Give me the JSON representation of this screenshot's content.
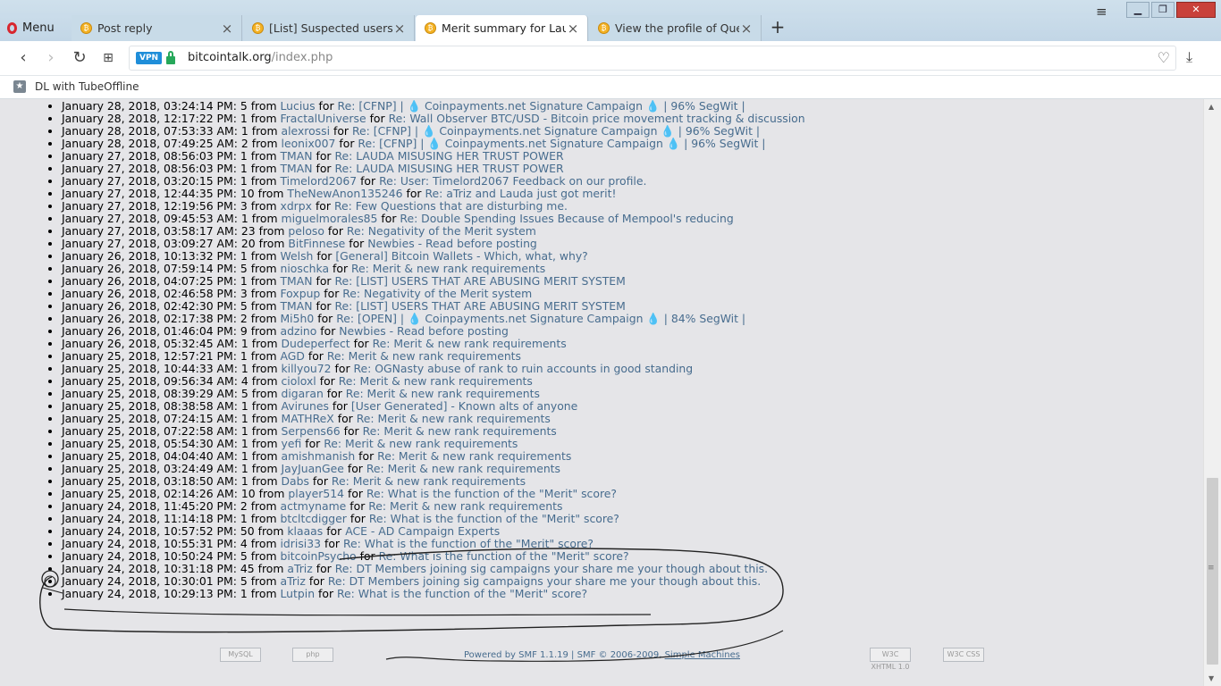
{
  "browser": {
    "menu_label": "Menu",
    "tabs": [
      {
        "title": "Post reply"
      },
      {
        "title": "[List] Suspected users that"
      },
      {
        "title": "Merit summary for Lauda"
      },
      {
        "title": "View the profile of Questio"
      }
    ],
    "new_tab": "+",
    "vpn_label": "VPN",
    "url_host": "bitcointalk.org",
    "url_path": "/index.php",
    "bookmark": "DL with TubeOffline"
  },
  "merits": [
    {
      "date": "January 28, 2018, 03:24:14 PM",
      "amount": "5",
      "user": "Lucius",
      "topic": "Re: [CFNP] | 💧 Coinpayments.net Signature Campaign 💧 | 96% SegWit |"
    },
    {
      "date": "January 28, 2018, 12:17:22 PM",
      "amount": "1",
      "user": "FractalUniverse",
      "topic": "Re: Wall Observer BTC/USD - Bitcoin price movement tracking & discussion"
    },
    {
      "date": "January 28, 2018, 07:53:33 AM",
      "amount": "1",
      "user": "alexrossi",
      "topic": "Re: [CFNP] | 💧 Coinpayments.net Signature Campaign 💧 | 96% SegWit |"
    },
    {
      "date": "January 28, 2018, 07:49:25 AM",
      "amount": "2",
      "user": "leonix007",
      "topic": "Re: [CFNP] | 💧 Coinpayments.net Signature Campaign 💧 | 96% SegWit |"
    },
    {
      "date": "January 27, 2018, 08:56:03 PM",
      "amount": "1",
      "user": "TMAN",
      "topic": "Re: LAUDA MISUSING HER TRUST POWER"
    },
    {
      "date": "January 27, 2018, 08:56:03 PM",
      "amount": "1",
      "user": "TMAN",
      "topic": "Re: LAUDA MISUSING HER TRUST POWER"
    },
    {
      "date": "January 27, 2018, 03:20:15 PM",
      "amount": "1",
      "user": "Timelord2067",
      "topic": "Re: User: Timelord2067 Feedback on our profile."
    },
    {
      "date": "January 27, 2018, 12:44:35 PM",
      "amount": "10",
      "user": "TheNewAnon135246",
      "topic": "Re: aTriz and Lauda just got merit!"
    },
    {
      "date": "January 27, 2018, 12:19:56 PM",
      "amount": "3",
      "user": "xdrpx",
      "topic": "Re: Few Questions that are disturbing me."
    },
    {
      "date": "January 27, 2018, 09:45:53 AM",
      "amount": "1",
      "user": "miguelmorales85",
      "topic": "Re: Double Spending Issues Because of Mempool's reducing"
    },
    {
      "date": "January 27, 2018, 03:58:17 AM",
      "amount": "23",
      "user": "peloso",
      "topic": "Re: Negativity of the Merit system"
    },
    {
      "date": "January 27, 2018, 03:09:27 AM",
      "amount": "20",
      "user": "BitFinnese",
      "topic": "Newbies - Read before posting"
    },
    {
      "date": "January 26, 2018, 10:13:32 PM",
      "amount": "1",
      "user": "Welsh",
      "topic": "[General] Bitcoin Wallets - Which, what, why?"
    },
    {
      "date": "January 26, 2018, 07:59:14 PM",
      "amount": "5",
      "user": "nioschka",
      "topic": "Re: Merit & new rank requirements"
    },
    {
      "date": "January 26, 2018, 04:07:25 PM",
      "amount": "1",
      "user": "TMAN",
      "topic": "Re: [LIST] USERS THAT ARE ABUSING MERIT SYSTEM"
    },
    {
      "date": "January 26, 2018, 02:46:58 PM",
      "amount": "3",
      "user": "Foxpup",
      "topic": "Re: Negativity of the Merit system"
    },
    {
      "date": "January 26, 2018, 02:42:30 PM",
      "amount": "5",
      "user": "TMAN",
      "topic": "Re: [LIST] USERS THAT ARE ABUSING MERIT SYSTEM"
    },
    {
      "date": "January 26, 2018, 02:17:38 PM",
      "amount": "2",
      "user": "Mi5h0",
      "topic": "Re: [OPEN] | 💧 Coinpayments.net Signature Campaign 💧 | 84% SegWit |"
    },
    {
      "date": "January 26, 2018, 01:46:04 PM",
      "amount": "9",
      "user": "adzino",
      "topic": "Newbies - Read before posting"
    },
    {
      "date": "January 26, 2018, 05:32:45 AM",
      "amount": "1",
      "user": "Dudeperfect",
      "topic": "Re: Merit & new rank requirements"
    },
    {
      "date": "January 25, 2018, 12:57:21 PM",
      "amount": "1",
      "user": "AGD",
      "topic": "Re: Merit & new rank requirements"
    },
    {
      "date": "January 25, 2018, 10:44:33 AM",
      "amount": "1",
      "user": "killyou72",
      "topic": "Re: OGNasty abuse of rank to ruin accounts in good standing"
    },
    {
      "date": "January 25, 2018, 09:56:34 AM",
      "amount": "4",
      "user": "cioloxl",
      "topic": "Re: Merit & new rank requirements"
    },
    {
      "date": "January 25, 2018, 08:39:29 AM",
      "amount": "5",
      "user": "digaran",
      "topic": "Re: Merit & new rank requirements"
    },
    {
      "date": "January 25, 2018, 08:38:58 AM",
      "amount": "1",
      "user": "Avirunes",
      "topic": "[User Generated] - Known alts of anyone"
    },
    {
      "date": "January 25, 2018, 07:24:15 AM",
      "amount": "1",
      "user": "MATHReX",
      "topic": "Re: Merit & new rank requirements"
    },
    {
      "date": "January 25, 2018, 07:22:58 AM",
      "amount": "1",
      "user": "Serpens66",
      "topic": "Re: Merit & new rank requirements"
    },
    {
      "date": "January 25, 2018, 05:54:30 AM",
      "amount": "1",
      "user": "yefi",
      "topic": "Re: Merit & new rank requirements"
    },
    {
      "date": "January 25, 2018, 04:04:40 AM",
      "amount": "1",
      "user": "amishmanish",
      "topic": "Re: Merit & new rank requirements"
    },
    {
      "date": "January 25, 2018, 03:24:49 AM",
      "amount": "1",
      "user": "JayJuanGee",
      "topic": "Re: Merit & new rank requirements"
    },
    {
      "date": "January 25, 2018, 03:18:50 AM",
      "amount": "1",
      "user": "Dabs",
      "topic": "Re: Merit & new rank requirements"
    },
    {
      "date": "January 25, 2018, 02:14:26 AM",
      "amount": "10",
      "user": "player514",
      "topic": "Re: What is the function of the \"Merit\" score?"
    },
    {
      "date": "January 24, 2018, 11:45:20 PM",
      "amount": "2",
      "user": "actmyname",
      "topic": "Re: Merit & new rank requirements"
    },
    {
      "date": "January 24, 2018, 11:14:18 PM",
      "amount": "1",
      "user": "btcltcdigger",
      "topic": "Re: What is the function of the \"Merit\" score?"
    },
    {
      "date": "January 24, 2018, 10:57:52 PM",
      "amount": "50",
      "user": "klaaas",
      "topic": "ACE - AD Campaign Experts"
    },
    {
      "date": "January 24, 2018, 10:55:31 PM",
      "amount": "4",
      "user": "idrisi33",
      "topic": "Re: What is the function of the \"Merit\" score?"
    },
    {
      "date": "January 24, 2018, 10:50:24 PM",
      "amount": "5",
      "user": "bitcoinPsycho",
      "topic": "Re: What is the function of the \"Merit\" score?"
    },
    {
      "date": "January 24, 2018, 10:31:18 PM",
      "amount": "45",
      "user": "aTriz",
      "topic": "Re: DT Members joining sig campaigns your share me your though about this."
    },
    {
      "date": "January 24, 2018, 10:30:01 PM",
      "amount": "5",
      "user": "aTriz",
      "topic": "Re: DT Members joining sig campaigns your share me your though about this."
    },
    {
      "date": "January 24, 2018, 10:29:13 PM",
      "amount": "1",
      "user": "Lutpin",
      "topic": "Re: What is the function of the \"Merit\" score?"
    }
  ],
  "list_labels": {
    "from": "from",
    "for": "for"
  },
  "footer": {
    "badge_mysql": "MySQL",
    "badge_php": "php",
    "powered_by": "Powered by SMF 1.1.19",
    "separator": "|",
    "copyright": "SMF © 2006-2009,",
    "simple_machines": "Simple Machines",
    "badge_xhtml": "W3C XHTML 1.0",
    "badge_css": "W3C CSS"
  }
}
